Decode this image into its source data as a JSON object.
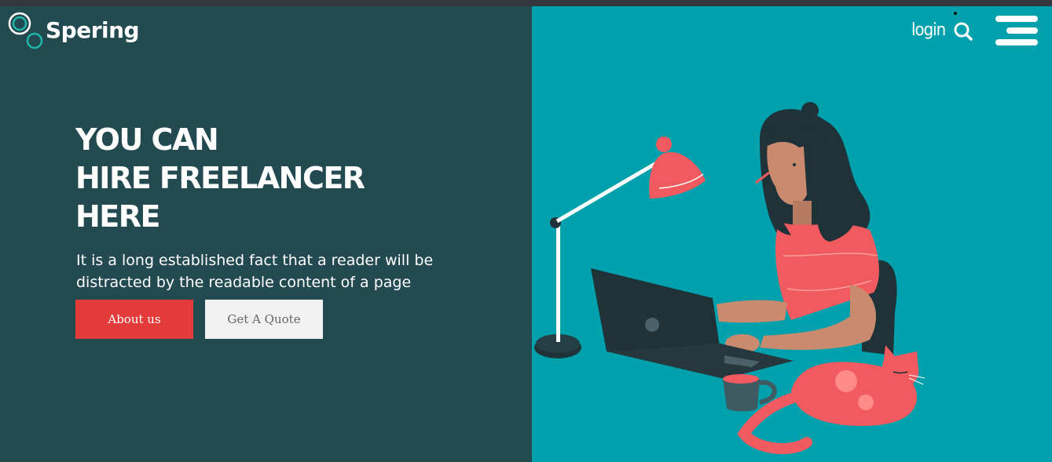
{
  "header": {
    "brand": "Spering",
    "login_label": "login",
    "icons": [
      "logo-rings-icon",
      "search-icon",
      "hamburger-menu-icon"
    ]
  },
  "hero": {
    "headline_lines": [
      "YOU CAN",
      "HIRE FREELANCER",
      "HERE"
    ],
    "description": "It is a long established fact that a reader will be distracted by the readable content of a page",
    "buttons": {
      "about_label": "About us",
      "quote_label": "Get A Quote"
    }
  },
  "colors": {
    "left_panel": "#234a51",
    "right_panel": "#00a0ad",
    "accent_red": "#e53a3a",
    "button_light": "#f1f1f1",
    "logo_teal": "#1fb5a9"
  }
}
